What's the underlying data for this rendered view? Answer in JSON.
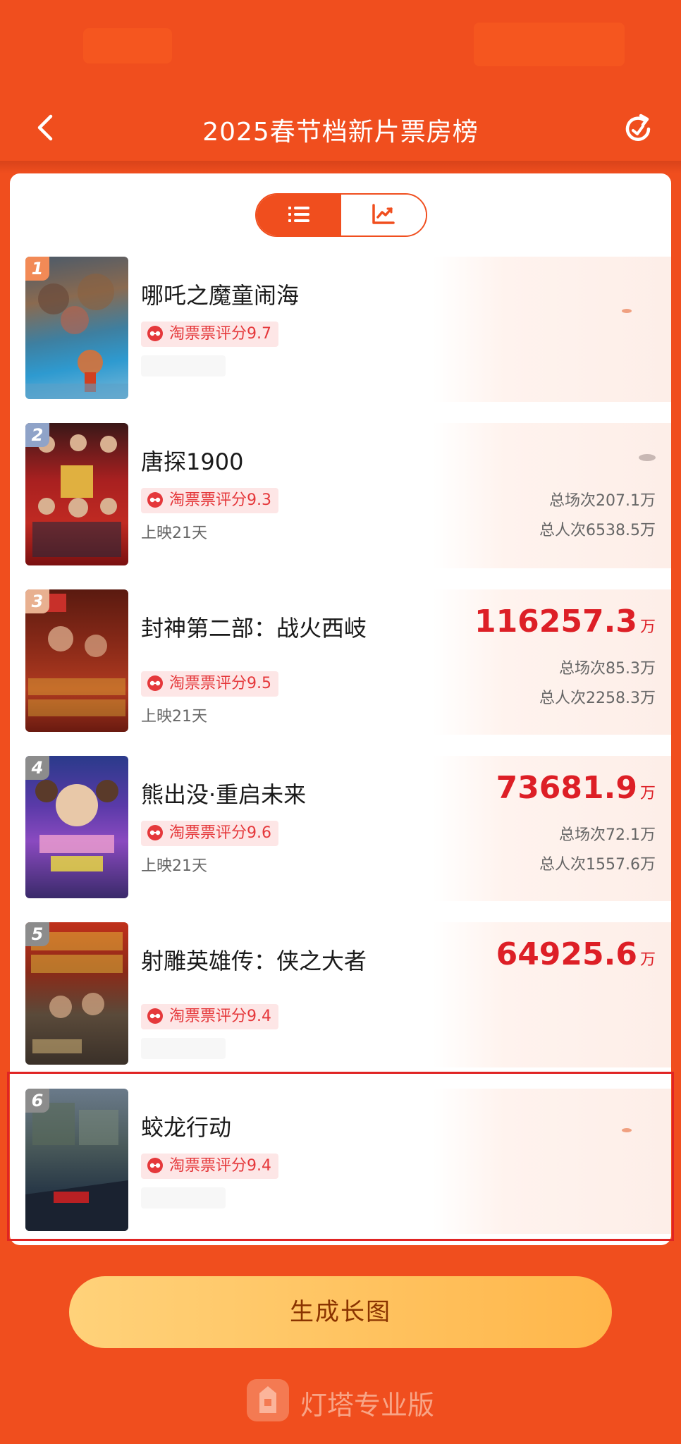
{
  "header": {
    "title": "2025春节档新片票房榜",
    "back_icon": "chevron-left-icon",
    "refresh_icon": "refresh-icon"
  },
  "toggle": {
    "list_icon": "list-icon",
    "chart_icon": "trend-chart-icon",
    "selected": "list"
  },
  "colors": {
    "primary": "#f04e1e",
    "boxoffice": "#dd1f26",
    "rating_bg": "#fde6e6",
    "rating_text": "#e5383b",
    "button": "#ffc25e"
  },
  "movies": [
    {
      "rank": "1",
      "title": "哪吒之魔童闹海",
      "rating": "淘票票评分9.7"
    },
    {
      "rank": "2",
      "title": "唐探1900",
      "rating": "淘票票评分9.3",
      "days": "上映21天",
      "screenings": "总场次207.1万",
      "admissions": "总人次6538.5万"
    },
    {
      "rank": "3",
      "title": "封神第二部：战火西岐",
      "rating": "淘票票评分9.5",
      "days": "上映21天",
      "boxoffice": "116257.3",
      "unit": "万",
      "screenings": "总场次85.3万",
      "admissions": "总人次2258.3万"
    },
    {
      "rank": "4",
      "title": "熊出没·重启未来",
      "rating": "淘票票评分9.6",
      "days": "上映21天",
      "boxoffice": "73681.9",
      "unit": "万",
      "screenings": "总场次72.1万",
      "admissions": "总人次1557.6万"
    },
    {
      "rank": "5",
      "title": "射雕英雄传：侠之大者",
      "rating": "淘票票评分9.4",
      "boxoffice": "64925.6",
      "unit": "万"
    },
    {
      "rank": "6",
      "title": "蛟龙行动",
      "rating": "淘票票评分9.4"
    }
  ],
  "actions": {
    "generate_label": "生成长图"
  },
  "brand": {
    "name": "灯塔专业版"
  }
}
